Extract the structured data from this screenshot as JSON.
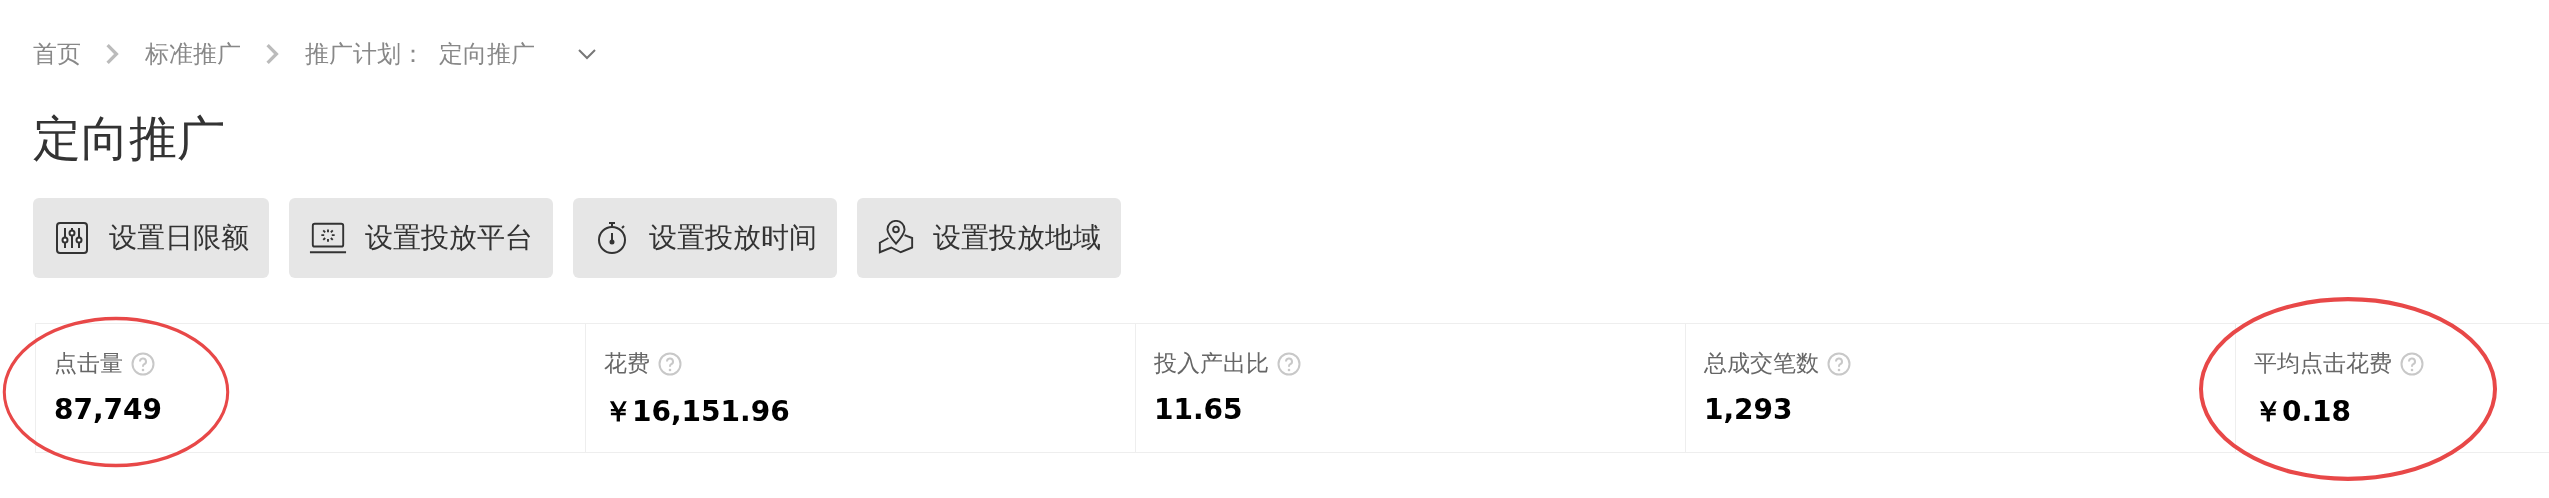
{
  "breadcrumb": [
    {
      "label": "首页"
    },
    {
      "label": "标准推广"
    },
    {
      "label": "推广计划：",
      "value": "定向推广"
    }
  ],
  "title": "定向推广",
  "actions": [
    {
      "label": "设置日限额",
      "kind": "sliders"
    },
    {
      "label": "设置投放平台",
      "kind": "platform"
    },
    {
      "label": "设置投放时间",
      "kind": "timer"
    },
    {
      "label": "设置投放地域",
      "kind": "region"
    }
  ],
  "metrics": [
    {
      "label": "点击量",
      "value": "87,749",
      "circled": true
    },
    {
      "label": "花费",
      "value": "￥16,151.96",
      "circled": false
    },
    {
      "label": "投入产出比",
      "value": "11.65",
      "circled": false
    },
    {
      "label": "总成交笔数",
      "value": "1,293",
      "circled": false
    },
    {
      "label": "平均点击花费",
      "value": "￥0.18",
      "circled": true
    }
  ]
}
